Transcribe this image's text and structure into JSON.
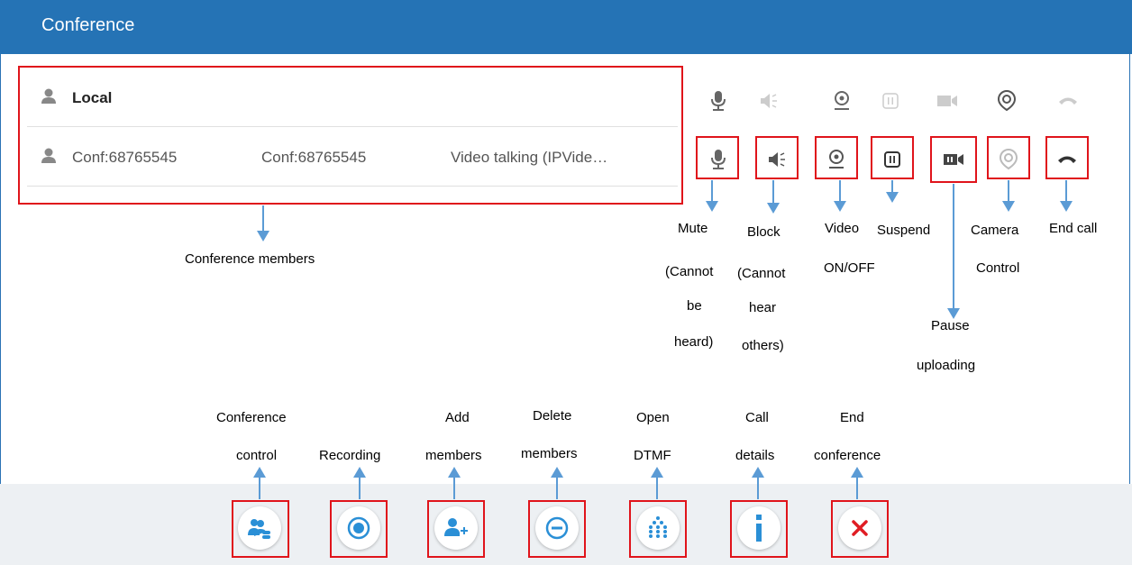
{
  "window": {
    "title": "Conference"
  },
  "members": [
    {
      "name": "Local"
    },
    {
      "name": "Conf:68765545",
      "number": "Conf:68765545",
      "status": "Video talking (IPVide…"
    }
  ],
  "labels": {
    "members": "Conference members",
    "mute": [
      "Mute",
      "(Cannot",
      "be",
      "heard)"
    ],
    "block": [
      "Block",
      "(Cannot",
      "hear",
      "others)"
    ],
    "video": [
      "Video",
      "ON/OFF"
    ],
    "suspend": [
      "Suspend"
    ],
    "pause": [
      "Pause",
      "uploading"
    ],
    "camera": [
      "Camera",
      "Control"
    ],
    "endcall": [
      "End call"
    ],
    "conf_control": [
      "Conference",
      "control"
    ],
    "recording": [
      "Recording"
    ],
    "add": [
      "Add",
      "members"
    ],
    "delete": [
      "Delete",
      "members"
    ],
    "dtmf": [
      "Open",
      "DTMF"
    ],
    "details": [
      "Call",
      "details"
    ],
    "endconf": [
      "End",
      "conference"
    ]
  },
  "icons": {
    "member_controls": [
      "microphone-icon",
      "speaker-icon",
      "webcam-icon",
      "suspend-icon",
      "video-camera-icon",
      "camera-control-icon",
      "hang-up-icon"
    ],
    "toolbar": [
      "conference-control-icon",
      "record-icon",
      "add-member-icon",
      "delete-member-icon",
      "dialpad-icon",
      "info-icon",
      "close-icon"
    ]
  },
  "colors": {
    "title_bar": "#2573b5",
    "highlight": "#e0141b",
    "arrow": "#5b9bd5",
    "toolbar_bg": "#edf0f3"
  }
}
